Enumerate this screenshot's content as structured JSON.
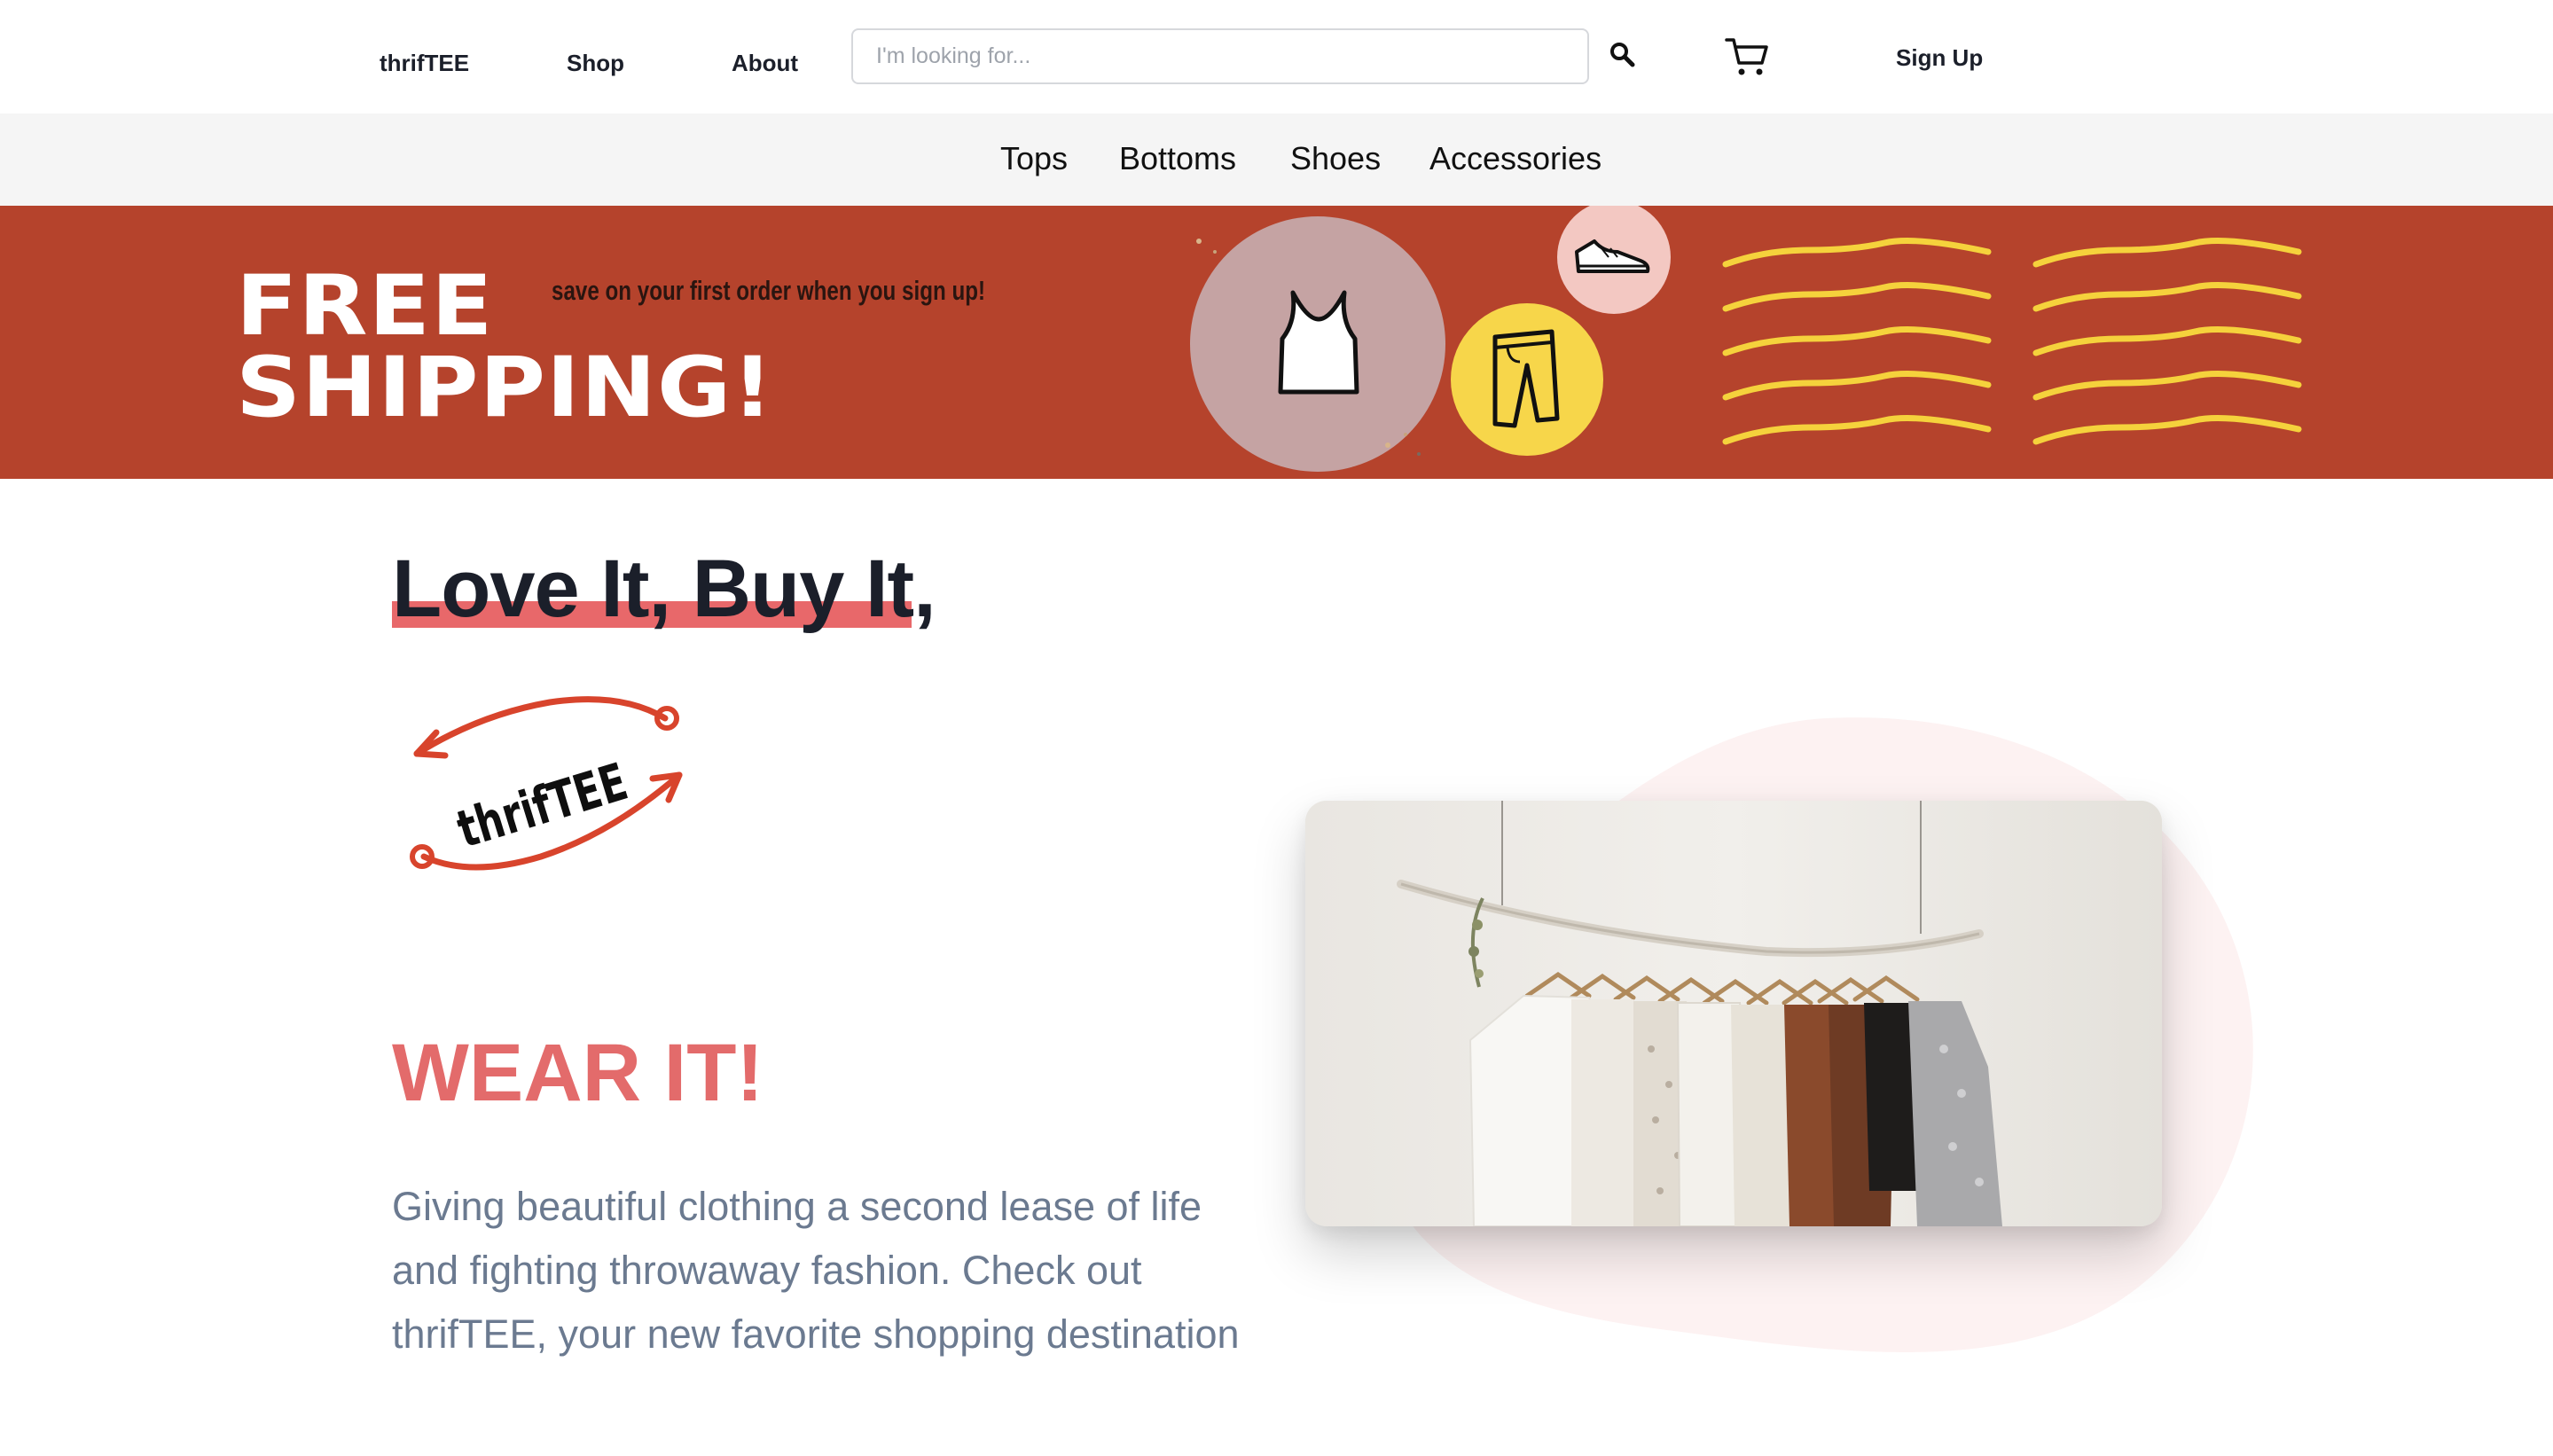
{
  "header": {
    "brand": "thrifTEE",
    "nav": [
      "Shop",
      "About"
    ],
    "search": {
      "placeholder": "I'm looking for...",
      "value": ""
    },
    "signup_label": "Sign Up",
    "icons": [
      "search-icon",
      "cart-icon"
    ]
  },
  "categories": [
    "Tops",
    "Bottoms",
    "Shoes",
    "Accessories"
  ],
  "banner": {
    "headline_line1": "FREE",
    "headline_line2": "SHIPPING!",
    "subtext": "save on your first order when you sign up!",
    "icons": [
      "tank-top-icon",
      "jeans-icon",
      "sneaker-icon"
    ],
    "background_color": "#b5432c",
    "accent_color": "#f5d23c"
  },
  "hero": {
    "title": "Love It, Buy It,",
    "logo_text": "thrifTEE",
    "subtitle": "WEAR IT!",
    "description": "Giving beautiful clothing a second lease of life and fighting throwaway fashion. Check out thrifTEE, your new favorite shopping destination",
    "accent_color": "#e36b6b"
  }
}
